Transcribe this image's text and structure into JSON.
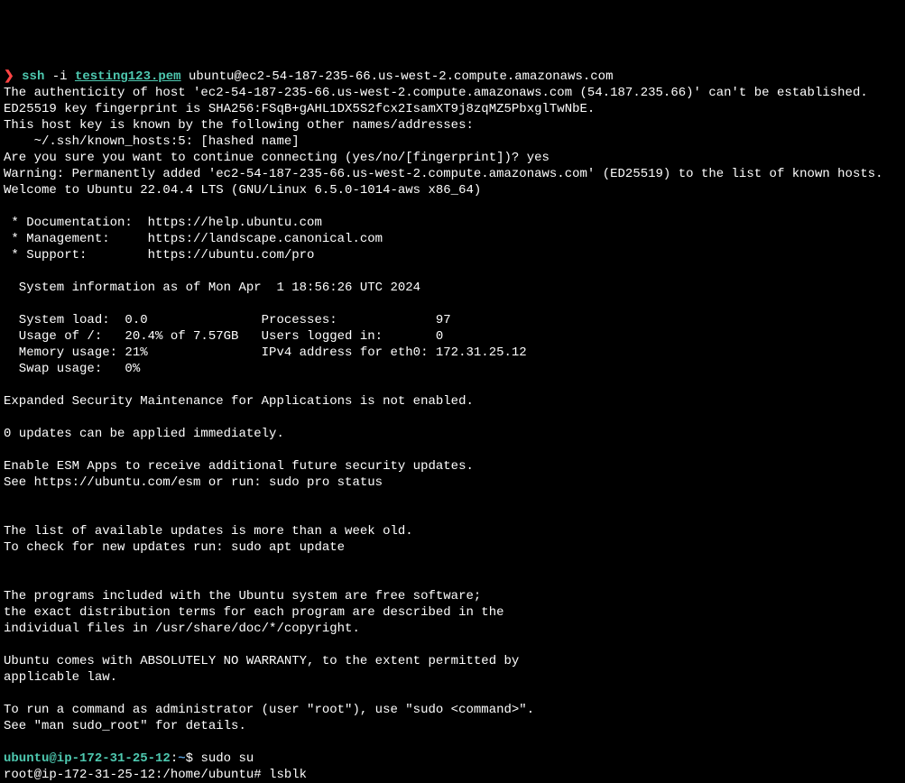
{
  "line1": {
    "arrow": "❯",
    "cmd": "ssh",
    "flag": " -i ",
    "pemfile": "testing123.pem",
    "rest": " ubuntu@ec2-54-187-235-66.us-west-2.compute.amazonaws.com"
  },
  "line2": "The authenticity of host 'ec2-54-187-235-66.us-west-2.compute.amazonaws.com (54.187.235.66)' can't be established.",
  "line3": "ED25519 key fingerprint is SHA256:FSqB+gAHL1DX5S2fcx2IsamXT9j8zqMZ5PbxglTwNbE.",
  "line4": "This host key is known by the following other names/addresses:",
  "line5": "    ~/.ssh/known_hosts:5: [hashed name]",
  "line6": "Are you sure you want to continue connecting (yes/no/[fingerprint])? yes",
  "line7": "Warning: Permanently added 'ec2-54-187-235-66.us-west-2.compute.amazonaws.com' (ED25519) to the list of known hosts.",
  "line8": "Welcome to Ubuntu 22.04.4 LTS (GNU/Linux 6.5.0-1014-aws x86_64)",
  "line9": "",
  "line10": " * Documentation:  https://help.ubuntu.com",
  "line11": " * Management:     https://landscape.canonical.com",
  "line12": " * Support:        https://ubuntu.com/pro",
  "line13": "",
  "line14": "  System information as of Mon Apr  1 18:56:26 UTC 2024",
  "line15": "",
  "line16": "  System load:  0.0               Processes:             97",
  "line17": "  Usage of /:   20.4% of 7.57GB   Users logged in:       0",
  "line18": "  Memory usage: 21%               IPv4 address for eth0: 172.31.25.12",
  "line19": "  Swap usage:   0%",
  "line20": "",
  "line21": "Expanded Security Maintenance for Applications is not enabled.",
  "line22": "",
  "line23": "0 updates can be applied immediately.",
  "line24": "",
  "line25": "Enable ESM Apps to receive additional future security updates.",
  "line26": "See https://ubuntu.com/esm or run: sudo pro status",
  "line27": "",
  "line28": "",
  "line29": "The list of available updates is more than a week old.",
  "line30": "To check for new updates run: sudo apt update",
  "line31": "",
  "line32": "",
  "line33": "The programs included with the Ubuntu system are free software;",
  "line34": "the exact distribution terms for each program are described in the",
  "line35": "individual files in /usr/share/doc/*/copyright.",
  "line36": "",
  "line37": "Ubuntu comes with ABSOLUTELY NO WARRANTY, to the extent permitted by",
  "line38": "applicable law.",
  "line39": "",
  "line40": "To run a command as administrator (user \"root\"), use \"sudo <command>\".",
  "line41": "See \"man sudo_root\" for details.",
  "line42": "",
  "prompt2": {
    "userhost": "ubuntu@ip-172-31-25-12",
    "colon": ":",
    "tilde": "~",
    "dollar": "$ ",
    "cmd": "sudo su"
  },
  "prompt3": {
    "full": "root@ip-172-31-25-12:/home/ubuntu# lsblk"
  }
}
